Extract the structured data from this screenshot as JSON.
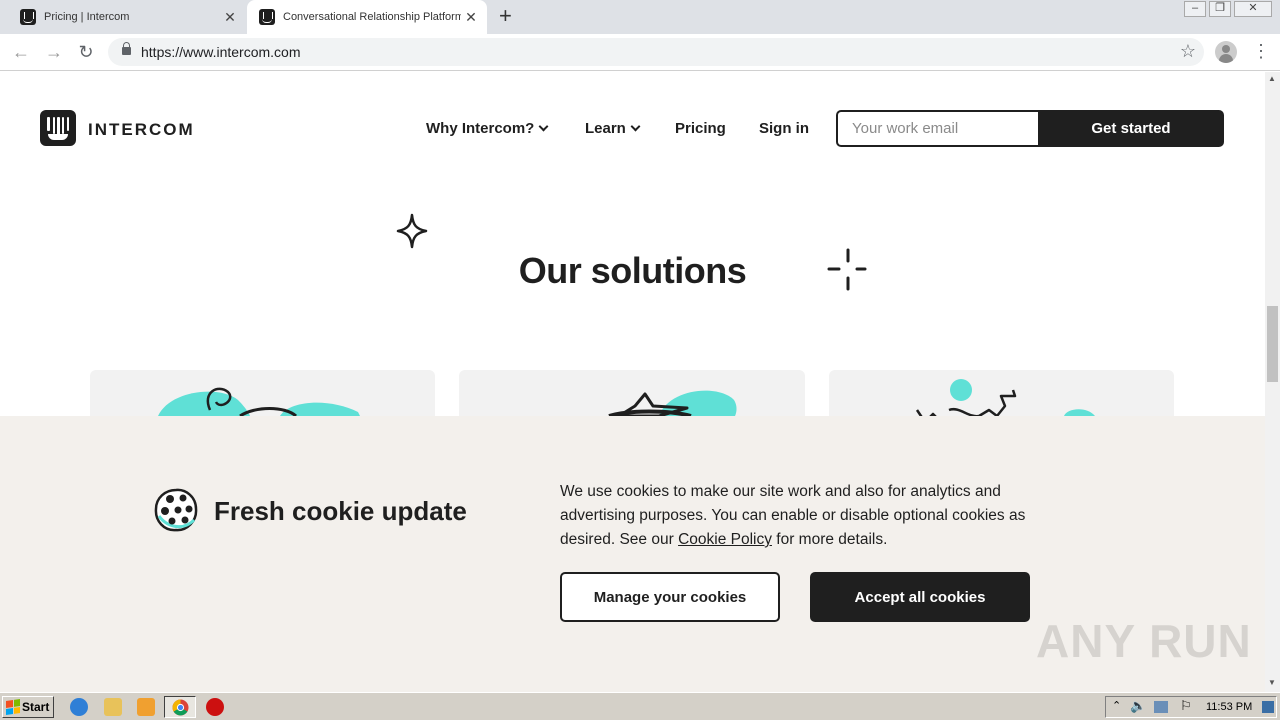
{
  "browser": {
    "tabs": [
      {
        "title": "Pricing | Intercom",
        "active": false
      },
      {
        "title": "Conversational Relationship Platform",
        "active": true
      }
    ],
    "new_tab": "+",
    "url": "https://www.intercom.com",
    "window_controls": {
      "minimize": "–",
      "restore": "❐",
      "close": "✕"
    }
  },
  "site": {
    "logo_text": "INTERCOM",
    "nav": {
      "why": "Why Intercom?",
      "learn": "Learn",
      "pricing": "Pricing",
      "signin": "Sign in"
    },
    "email_placeholder": "Your work email",
    "cta": "Get started",
    "section_title": "Our solutions"
  },
  "cookie_banner": {
    "title": "Fresh cookie update",
    "text_before": "We use cookies to make our site work and also for analytics and advertising purposes. You can enable or disable optional cookies as desired. See our",
    "link": "Cookie Policy",
    "text_after": "for more details.",
    "manage_label": "Manage your cookies",
    "accept_label": "Accept all cookies"
  },
  "watermark": "ANY RUN",
  "taskbar": {
    "start_label": "Start",
    "clock": "11:53 PM"
  },
  "colors": {
    "brand_dark": "#1f1f1f",
    "accent_teal": "#5fe0d6",
    "banner_bg": "#f3f0ec"
  }
}
